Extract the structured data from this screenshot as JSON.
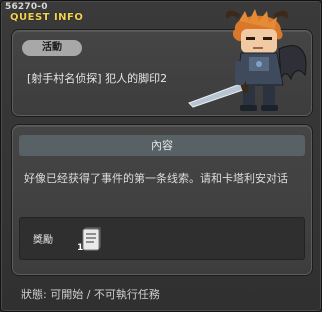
{
  "window": {
    "quest_id": "56270-0",
    "title": "QUEST INFO"
  },
  "top": {
    "tag": "活動",
    "quest_name": "[射手村名侦探] 犯人的脚印2"
  },
  "content": {
    "header": "內容",
    "description": "好像已经获得了事件的第一条线索。请和卡塔利安对话",
    "reward_label": "獎勵",
    "reward_item": {
      "icon": "document-item-icon",
      "count": "1"
    }
  },
  "status": "狀態: 可開始 / 不可執行任務"
}
